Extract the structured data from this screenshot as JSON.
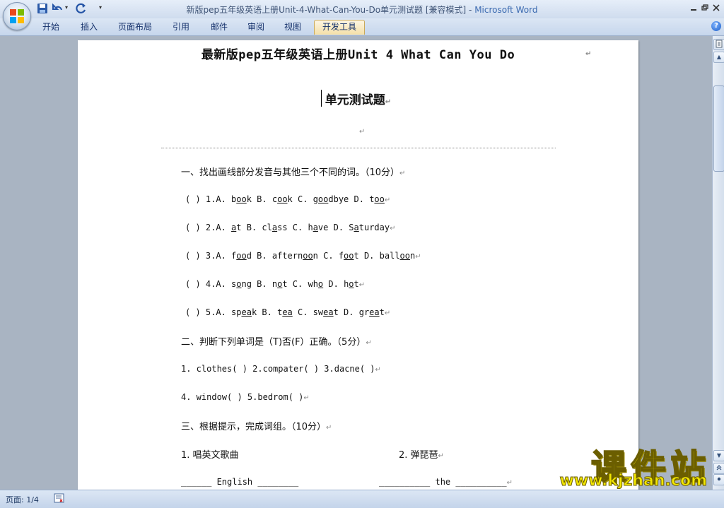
{
  "window": {
    "title_doc": "新版pep五年级英语上册Unit-4-What-Can-You-Do单元测试题 [兼容模式]",
    "title_sep": " - ",
    "title_app": "Microsoft Word"
  },
  "qat": {
    "save_icon": "save-icon",
    "undo_icon": "undo-icon",
    "redo_icon": "redo-icon",
    "more": "▾"
  },
  "ribbon": {
    "tabs": [
      "开始",
      "插入",
      "页面布局",
      "引用",
      "邮件",
      "审阅",
      "视图",
      "开发工具"
    ],
    "active_tab_index": 7,
    "help": "?"
  },
  "document": {
    "heading": "最新版pep五年级英语上册Unit 4 What Can You Do",
    "subheading": "单元测试题",
    "para_mark": "↵",
    "section1": "一、找出画线部分发音与其他三个不同的词。（10分）",
    "q1": {
      "prefix": "( ) 1.A. ",
      "a": [
        "b",
        "oo",
        "k"
      ],
      "b_pre": " B. ",
      "b": [
        "c",
        "oo",
        "k"
      ],
      "c_pre": " C. ",
      "c": [
        "g",
        "oo",
        "dbye"
      ],
      "d_pre": " D. ",
      "d": [
        "t",
        "oo",
        ""
      ]
    },
    "q2": {
      "prefix": "( ) 2.A. ",
      "a": [
        "",
        "a",
        "t"
      ],
      "b_pre": " B. ",
      "b": [
        "cl",
        "a",
        "ss"
      ],
      "c_pre": " C. ",
      "c": [
        "h",
        "a",
        "ve"
      ],
      "d_pre": " D. ",
      "d": [
        "S",
        "a",
        "turday"
      ]
    },
    "q3": {
      "prefix": "( ) 3.A. ",
      "a": [
        "f",
        "oo",
        "d"
      ],
      "b_pre": " B. ",
      "b": [
        "aftern",
        "oo",
        "n"
      ],
      "c_pre": " C. ",
      "c": [
        "f",
        "oo",
        "t"
      ],
      "d_pre": " D. ",
      "d": [
        "ball",
        "oo",
        "n"
      ]
    },
    "q4": {
      "prefix": "( ) 4.A. ",
      "a": [
        "s",
        "o",
        "ng"
      ],
      "b_pre": " B. ",
      "b": [
        "n",
        "o",
        "t"
      ],
      "c_pre": " C. ",
      "c": [
        "wh",
        "o",
        ""
      ],
      "d_pre": " D. ",
      "d": [
        "h",
        "o",
        "t"
      ]
    },
    "q5": {
      "prefix": "( ) 5.A. ",
      "a": [
        "sp",
        "ea",
        "k"
      ],
      "b_pre": " B. ",
      "b": [
        "t",
        "ea",
        ""
      ],
      "c_pre": " C. ",
      "c": [
        "sw",
        "ea",
        "t"
      ],
      "d_pre": " D. ",
      "d": [
        "gr",
        "ea",
        "t"
      ]
    },
    "section2": "二、判断下列单词是（T)否(F）正确。（5分）",
    "s2_line1": "1. clothes( ) 2.compater( ) 3.dacne( )",
    "s2_line2": "4. window( ) 5.bedrom( )",
    "section3": "三、根据提示，完成词组。（10分）",
    "s3_item1": "1. 唱英文歌曲",
    "s3_item2": "2. 弹琵琶",
    "s3_blank1": "______ English ________",
    "s3_blank2": "__________ the __________"
  },
  "watermark": {
    "main": "课件站",
    "url": "www.kjzhan.com"
  },
  "scrollbar": {
    "up": "▲",
    "down": "▼"
  },
  "status": {
    "page": "页面: 1/4"
  }
}
